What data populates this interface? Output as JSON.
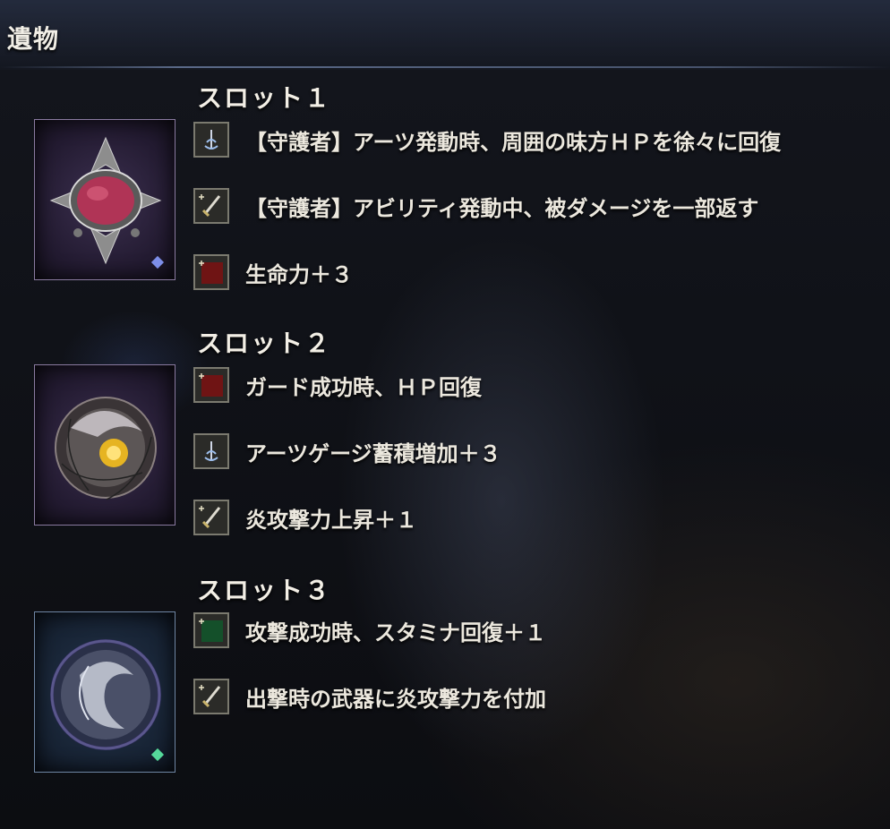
{
  "header": {
    "title": "遺物"
  },
  "slots": [
    {
      "heading": "スロット１",
      "relic": {
        "frame": "purple",
        "gem": "red-jewel-brooch",
        "badge_color": "#7d8ee8"
      },
      "effects": [
        {
          "icon": "arts-icon",
          "text": "【守護者】アーツ発動時、周囲の味方ＨＰを徐々に回復"
        },
        {
          "icon": "sword-icon",
          "text": "【守護者】アビリティ発動中、被ダメージを一部返す"
        },
        {
          "icon": "red-square-icon",
          "text": "生命力＋３"
        }
      ]
    },
    {
      "heading": "スロット２",
      "relic": {
        "frame": "purple",
        "gem": "golden-orb-nest",
        "badge_color": ""
      },
      "effects": [
        {
          "icon": "red-square-icon",
          "text": "ガード成功時、ＨＰ回復"
        },
        {
          "icon": "arts-icon",
          "text": "アーツゲージ蓄積増加＋３"
        },
        {
          "icon": "sword-icon",
          "text": "炎攻撃力上昇＋１"
        }
      ]
    },
    {
      "heading": "スロット３",
      "relic": {
        "frame": "blue",
        "gem": "silver-dragon-medallion",
        "badge_color": "#55d99a"
      },
      "effects": [
        {
          "icon": "green-square-icon",
          "text": "攻撃成功時、スタミナ回復＋１"
        },
        {
          "icon": "sword-icon",
          "text": "出撃時の武器に炎攻撃力を付加"
        }
      ]
    }
  ]
}
